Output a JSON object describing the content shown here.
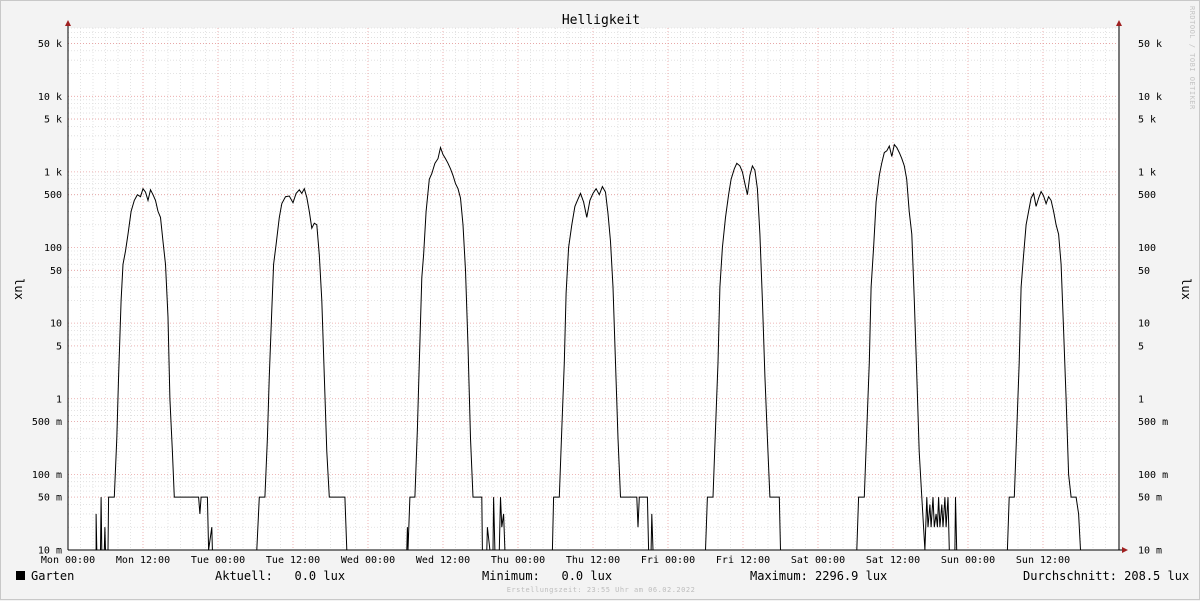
{
  "chart_data": {
    "type": "line",
    "title": "Helligkeit",
    "ylabel": "lux",
    "ylabel_right": "lux",
    "y_scale": "log",
    "ylim": [
      0.01,
      80000
    ],
    "x_range_hours": [
      0,
      168
    ],
    "grid": true,
    "x_ticks": [
      {
        "h": 0,
        "label": "Mon 00:00"
      },
      {
        "h": 12,
        "label": "Mon 12:00"
      },
      {
        "h": 24,
        "label": "Tue 00:00"
      },
      {
        "h": 36,
        "label": "Tue 12:00"
      },
      {
        "h": 48,
        "label": "Wed 00:00"
      },
      {
        "h": 60,
        "label": "Wed 12:00"
      },
      {
        "h": 72,
        "label": "Thu 00:00"
      },
      {
        "h": 84,
        "label": "Thu 12:00"
      },
      {
        "h": 96,
        "label": "Fri 00:00"
      },
      {
        "h": 108,
        "label": "Fri 12:00"
      },
      {
        "h": 120,
        "label": "Sat 00:00"
      },
      {
        "h": 132,
        "label": "Sat 12:00"
      },
      {
        "h": 144,
        "label": "Sun 00:00"
      },
      {
        "h": 156,
        "label": "Sun 12:00"
      }
    ],
    "y_ticks": [
      {
        "v": 50000,
        "label": "50 k"
      },
      {
        "v": 10000,
        "label": "10 k"
      },
      {
        "v": 5000,
        "label": "5 k"
      },
      {
        "v": 1000,
        "label": "1 k"
      },
      {
        "v": 500,
        "label": "500"
      },
      {
        "v": 100,
        "label": "100"
      },
      {
        "v": 50,
        "label": "50"
      },
      {
        "v": 10,
        "label": "10"
      },
      {
        "v": 5,
        "label": "5"
      },
      {
        "v": 1,
        "label": "1"
      },
      {
        "v": 0.5,
        "label": "500 m"
      },
      {
        "v": 0.1,
        "label": "100 m"
      },
      {
        "v": 0.05,
        "label": "50 m"
      },
      {
        "v": 0.01,
        "label": "10 m"
      }
    ],
    "series": [
      {
        "name": "Garten",
        "color": "#000000",
        "points": [
          [
            0,
            0.01
          ],
          [
            4.5,
            0.01
          ],
          [
            4.5,
            0.03
          ],
          [
            4.6,
            0.01
          ],
          [
            5.2,
            0.01
          ],
          [
            5.3,
            0.05
          ],
          [
            5.4,
            0.01
          ],
          [
            5.8,
            0.01
          ],
          [
            5.9,
            0.02
          ],
          [
            6.0,
            0.01
          ],
          [
            6.4,
            0.01
          ],
          [
            6.5,
            0.05
          ],
          [
            7.4,
            0.05
          ],
          [
            7.8,
            0.3
          ],
          [
            8.1,
            2
          ],
          [
            8.5,
            20
          ],
          [
            8.8,
            60
          ],
          [
            9.2,
            90
          ],
          [
            9.6,
            150
          ],
          [
            10.1,
            300
          ],
          [
            10.6,
            420
          ],
          [
            11.1,
            500
          ],
          [
            11.6,
            470
          ],
          [
            12.0,
            600
          ],
          [
            12.4,
            540
          ],
          [
            12.8,
            420
          ],
          [
            13.2,
            580
          ],
          [
            13.6,
            500
          ],
          [
            14.0,
            420
          ],
          [
            14.4,
            300
          ],
          [
            14.8,
            250
          ],
          [
            15.2,
            120
          ],
          [
            15.6,
            60
          ],
          [
            16.0,
            12
          ],
          [
            16.3,
            1
          ],
          [
            16.7,
            0.2
          ],
          [
            17.0,
            0.05
          ],
          [
            20.9,
            0.05
          ],
          [
            21.1,
            0.03
          ],
          [
            21.3,
            0.05
          ],
          [
            22.3,
            0.05
          ],
          [
            22.5,
            0.01
          ],
          [
            23.0,
            0.02
          ],
          [
            23.1,
            0.01
          ],
          [
            30.2,
            0.01
          ],
          [
            30.6,
            0.05
          ],
          [
            31.5,
            0.05
          ],
          [
            31.9,
            0.3
          ],
          [
            32.2,
            2
          ],
          [
            32.6,
            15
          ],
          [
            32.9,
            60
          ],
          [
            33.3,
            110
          ],
          [
            33.8,
            250
          ],
          [
            34.2,
            380
          ],
          [
            34.8,
            470
          ],
          [
            35.4,
            480
          ],
          [
            36.0,
            390
          ],
          [
            36.5,
            520
          ],
          [
            37.0,
            580
          ],
          [
            37.4,
            520
          ],
          [
            37.8,
            600
          ],
          [
            38.2,
            460
          ],
          [
            38.6,
            300
          ],
          [
            39.0,
            180
          ],
          [
            39.4,
            210
          ],
          [
            39.8,
            200
          ],
          [
            40.2,
            80
          ],
          [
            40.6,
            20
          ],
          [
            41.0,
            2
          ],
          [
            41.4,
            0.2
          ],
          [
            41.8,
            0.05
          ],
          [
            44.3,
            0.05
          ],
          [
            44.6,
            0.01
          ],
          [
            54.2,
            0.01
          ],
          [
            54.3,
            0.02
          ],
          [
            54.4,
            0.01
          ],
          [
            54.7,
            0.05
          ],
          [
            55.5,
            0.05
          ],
          [
            55.9,
            0.4
          ],
          [
            56.2,
            3
          ],
          [
            56.6,
            40
          ],
          [
            56.9,
            80
          ],
          [
            57.3,
            300
          ],
          [
            57.8,
            800
          ],
          [
            58.2,
            950
          ],
          [
            58.7,
            1300
          ],
          [
            59.2,
            1500
          ],
          [
            59.6,
            2100
          ],
          [
            60.0,
            1700
          ],
          [
            60.4,
            1500
          ],
          [
            60.8,
            1300
          ],
          [
            61.2,
            1100
          ],
          [
            61.6,
            900
          ],
          [
            62.0,
            700
          ],
          [
            62.4,
            600
          ],
          [
            62.8,
            450
          ],
          [
            63.2,
            200
          ],
          [
            63.6,
            50
          ],
          [
            64.0,
            5
          ],
          [
            64.4,
            0.3
          ],
          [
            64.8,
            0.05
          ],
          [
            66.2,
            0.05
          ],
          [
            66.3,
            0.01
          ],
          [
            67.0,
            0.01
          ],
          [
            67.1,
            0.02
          ],
          [
            67.5,
            0.01
          ],
          [
            68.0,
            0.01
          ],
          [
            68.1,
            0.05
          ],
          [
            68.3,
            0.01
          ],
          [
            69.0,
            0.01
          ],
          [
            69.2,
            0.05
          ],
          [
            69.4,
            0.02
          ],
          [
            69.7,
            0.03
          ],
          [
            69.9,
            0.01
          ],
          [
            77.5,
            0.01
          ],
          [
            77.7,
            0.05
          ],
          [
            78.6,
            0.05
          ],
          [
            79.0,
            0.4
          ],
          [
            79.4,
            3
          ],
          [
            79.7,
            25
          ],
          [
            80.1,
            100
          ],
          [
            80.6,
            200
          ],
          [
            81.1,
            350
          ],
          [
            81.5,
            420
          ],
          [
            82.0,
            520
          ],
          [
            82.5,
            400
          ],
          [
            83.0,
            250
          ],
          [
            83.5,
            420
          ],
          [
            84.0,
            520
          ],
          [
            84.5,
            600
          ],
          [
            85.0,
            500
          ],
          [
            85.5,
            640
          ],
          [
            86.0,
            540
          ],
          [
            86.4,
            280
          ],
          [
            86.8,
            120
          ],
          [
            87.2,
            30
          ],
          [
            87.6,
            3
          ],
          [
            88.0,
            0.3
          ],
          [
            88.4,
            0.05
          ],
          [
            91.0,
            0.05
          ],
          [
            91.2,
            0.02
          ],
          [
            91.4,
            0.05
          ],
          [
            92.7,
            0.05
          ],
          [
            92.9,
            0.01
          ],
          [
            93.3,
            0.01
          ],
          [
            93.4,
            0.03
          ],
          [
            93.6,
            0.01
          ],
          [
            102.0,
            0.01
          ],
          [
            102.3,
            0.05
          ],
          [
            103.2,
            0.05
          ],
          [
            103.6,
            0.4
          ],
          [
            104.0,
            3
          ],
          [
            104.3,
            30
          ],
          [
            104.7,
            100
          ],
          [
            105.2,
            250
          ],
          [
            105.7,
            500
          ],
          [
            106.1,
            800
          ],
          [
            106.6,
            1100
          ],
          [
            107.0,
            1300
          ],
          [
            107.5,
            1200
          ],
          [
            107.9,
            1000
          ],
          [
            108.3,
            700
          ],
          [
            108.7,
            500
          ],
          [
            109.1,
            900
          ],
          [
            109.5,
            1200
          ],
          [
            109.9,
            1050
          ],
          [
            110.3,
            600
          ],
          [
            110.7,
            150
          ],
          [
            111.1,
            20
          ],
          [
            111.5,
            2
          ],
          [
            111.9,
            0.3
          ],
          [
            112.3,
            0.05
          ],
          [
            113.8,
            0.05
          ],
          [
            114.0,
            0.01
          ],
          [
            126.2,
            0.01
          ],
          [
            126.5,
            0.05
          ],
          [
            127.4,
            0.05
          ],
          [
            127.8,
            0.4
          ],
          [
            128.2,
            3
          ],
          [
            128.5,
            30
          ],
          [
            128.9,
            100
          ],
          [
            129.3,
            400
          ],
          [
            129.8,
            900
          ],
          [
            130.2,
            1300
          ],
          [
            130.6,
            1800
          ],
          [
            131.0,
            1900
          ],
          [
            131.4,
            2200
          ],
          [
            131.8,
            1600
          ],
          [
            132.2,
            2297
          ],
          [
            132.6,
            2100
          ],
          [
            133.0,
            1800
          ],
          [
            133.4,
            1500
          ],
          [
            133.8,
            1200
          ],
          [
            134.2,
            800
          ],
          [
            134.6,
            300
          ],
          [
            135.0,
            150
          ],
          [
            135.4,
            20
          ],
          [
            135.8,
            2
          ],
          [
            136.2,
            0.2
          ],
          [
            136.6,
            0.05
          ],
          [
            137.1,
            0.01
          ],
          [
            137.4,
            0.05
          ],
          [
            137.6,
            0.02
          ],
          [
            137.9,
            0.04
          ],
          [
            138.1,
            0.02
          ],
          [
            138.4,
            0.05
          ],
          [
            138.6,
            0.02
          ],
          [
            138.9,
            0.03
          ],
          [
            139.1,
            0.02
          ],
          [
            139.3,
            0.05
          ],
          [
            139.5,
            0.02
          ],
          [
            139.8,
            0.04
          ],
          [
            140.0,
            0.02
          ],
          [
            140.3,
            0.05
          ],
          [
            140.5,
            0.02
          ],
          [
            140.8,
            0.05
          ],
          [
            141.0,
            0.01
          ],
          [
            141.9,
            0.01
          ],
          [
            142.0,
            0.05
          ],
          [
            142.2,
            0.01
          ],
          [
            150.3,
            0.01
          ],
          [
            150.6,
            0.05
          ],
          [
            151.4,
            0.05
          ],
          [
            151.8,
            0.4
          ],
          [
            152.2,
            3
          ],
          [
            152.5,
            30
          ],
          [
            152.9,
            80
          ],
          [
            153.3,
            200
          ],
          [
            153.7,
            300
          ],
          [
            154.1,
            450
          ],
          [
            154.5,
            520
          ],
          [
            154.9,
            350
          ],
          [
            155.3,
            450
          ],
          [
            155.7,
            550
          ],
          [
            156.1,
            480
          ],
          [
            156.5,
            380
          ],
          [
            156.9,
            470
          ],
          [
            157.3,
            420
          ],
          [
            157.7,
            300
          ],
          [
            158.1,
            200
          ],
          [
            158.5,
            150
          ],
          [
            158.9,
            60
          ],
          [
            159.3,
            8
          ],
          [
            159.7,
            1
          ],
          [
            160.1,
            0.1
          ],
          [
            160.5,
            0.05
          ],
          [
            161.3,
            0.05
          ],
          [
            161.7,
            0.03
          ],
          [
            162.0,
            0.01
          ],
          [
            168.0,
            0.01
          ]
        ]
      }
    ]
  },
  "legend": {
    "series_name": "Garten",
    "aktuell": "Aktuell:   0.0 lux",
    "minimum": "Minimum:   0.0 lux",
    "maximum": "Maximum: 2296.9 lux",
    "durchschnitt": "Durchschnitt: 208.5 lux"
  },
  "footer": "Erstellungszeit: 23:55 Uhr am 06.02.2022",
  "watermark": "RRDTOOL / TOBI OETIKER",
  "colors": {
    "background": "#f3f3f3",
    "plot_background": "#ffffff",
    "major_grid": "#e8a0a0",
    "minor_grid": "#dcdcdc",
    "axis": "#000000",
    "arrow": "#a02020",
    "line": "#000000"
  }
}
